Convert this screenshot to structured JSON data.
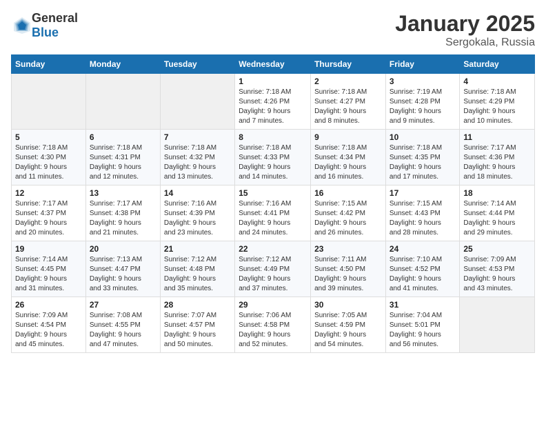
{
  "logo": {
    "general": "General",
    "blue": "Blue"
  },
  "title": "January 2025",
  "location": "Sergokala, Russia",
  "days_of_week": [
    "Sunday",
    "Monday",
    "Tuesday",
    "Wednesday",
    "Thursday",
    "Friday",
    "Saturday"
  ],
  "weeks": [
    [
      {
        "day": "",
        "info": ""
      },
      {
        "day": "",
        "info": ""
      },
      {
        "day": "",
        "info": ""
      },
      {
        "day": "1",
        "info": "Sunrise: 7:18 AM\nSunset: 4:26 PM\nDaylight: 9 hours\nand 7 minutes."
      },
      {
        "day": "2",
        "info": "Sunrise: 7:18 AM\nSunset: 4:27 PM\nDaylight: 9 hours\nand 8 minutes."
      },
      {
        "day": "3",
        "info": "Sunrise: 7:19 AM\nSunset: 4:28 PM\nDaylight: 9 hours\nand 9 minutes."
      },
      {
        "day": "4",
        "info": "Sunrise: 7:18 AM\nSunset: 4:29 PM\nDaylight: 9 hours\nand 10 minutes."
      }
    ],
    [
      {
        "day": "5",
        "info": "Sunrise: 7:18 AM\nSunset: 4:30 PM\nDaylight: 9 hours\nand 11 minutes."
      },
      {
        "day": "6",
        "info": "Sunrise: 7:18 AM\nSunset: 4:31 PM\nDaylight: 9 hours\nand 12 minutes."
      },
      {
        "day": "7",
        "info": "Sunrise: 7:18 AM\nSunset: 4:32 PM\nDaylight: 9 hours\nand 13 minutes."
      },
      {
        "day": "8",
        "info": "Sunrise: 7:18 AM\nSunset: 4:33 PM\nDaylight: 9 hours\nand 14 minutes."
      },
      {
        "day": "9",
        "info": "Sunrise: 7:18 AM\nSunset: 4:34 PM\nDaylight: 9 hours\nand 16 minutes."
      },
      {
        "day": "10",
        "info": "Sunrise: 7:18 AM\nSunset: 4:35 PM\nDaylight: 9 hours\nand 17 minutes."
      },
      {
        "day": "11",
        "info": "Sunrise: 7:17 AM\nSunset: 4:36 PM\nDaylight: 9 hours\nand 18 minutes."
      }
    ],
    [
      {
        "day": "12",
        "info": "Sunrise: 7:17 AM\nSunset: 4:37 PM\nDaylight: 9 hours\nand 20 minutes."
      },
      {
        "day": "13",
        "info": "Sunrise: 7:17 AM\nSunset: 4:38 PM\nDaylight: 9 hours\nand 21 minutes."
      },
      {
        "day": "14",
        "info": "Sunrise: 7:16 AM\nSunset: 4:39 PM\nDaylight: 9 hours\nand 23 minutes."
      },
      {
        "day": "15",
        "info": "Sunrise: 7:16 AM\nSunset: 4:41 PM\nDaylight: 9 hours\nand 24 minutes."
      },
      {
        "day": "16",
        "info": "Sunrise: 7:15 AM\nSunset: 4:42 PM\nDaylight: 9 hours\nand 26 minutes."
      },
      {
        "day": "17",
        "info": "Sunrise: 7:15 AM\nSunset: 4:43 PM\nDaylight: 9 hours\nand 28 minutes."
      },
      {
        "day": "18",
        "info": "Sunrise: 7:14 AM\nSunset: 4:44 PM\nDaylight: 9 hours\nand 29 minutes."
      }
    ],
    [
      {
        "day": "19",
        "info": "Sunrise: 7:14 AM\nSunset: 4:45 PM\nDaylight: 9 hours\nand 31 minutes."
      },
      {
        "day": "20",
        "info": "Sunrise: 7:13 AM\nSunset: 4:47 PM\nDaylight: 9 hours\nand 33 minutes."
      },
      {
        "day": "21",
        "info": "Sunrise: 7:12 AM\nSunset: 4:48 PM\nDaylight: 9 hours\nand 35 minutes."
      },
      {
        "day": "22",
        "info": "Sunrise: 7:12 AM\nSunset: 4:49 PM\nDaylight: 9 hours\nand 37 minutes."
      },
      {
        "day": "23",
        "info": "Sunrise: 7:11 AM\nSunset: 4:50 PM\nDaylight: 9 hours\nand 39 minutes."
      },
      {
        "day": "24",
        "info": "Sunrise: 7:10 AM\nSunset: 4:52 PM\nDaylight: 9 hours\nand 41 minutes."
      },
      {
        "day": "25",
        "info": "Sunrise: 7:09 AM\nSunset: 4:53 PM\nDaylight: 9 hours\nand 43 minutes."
      }
    ],
    [
      {
        "day": "26",
        "info": "Sunrise: 7:09 AM\nSunset: 4:54 PM\nDaylight: 9 hours\nand 45 minutes."
      },
      {
        "day": "27",
        "info": "Sunrise: 7:08 AM\nSunset: 4:55 PM\nDaylight: 9 hours\nand 47 minutes."
      },
      {
        "day": "28",
        "info": "Sunrise: 7:07 AM\nSunset: 4:57 PM\nDaylight: 9 hours\nand 50 minutes."
      },
      {
        "day": "29",
        "info": "Sunrise: 7:06 AM\nSunset: 4:58 PM\nDaylight: 9 hours\nand 52 minutes."
      },
      {
        "day": "30",
        "info": "Sunrise: 7:05 AM\nSunset: 4:59 PM\nDaylight: 9 hours\nand 54 minutes."
      },
      {
        "day": "31",
        "info": "Sunrise: 7:04 AM\nSunset: 5:01 PM\nDaylight: 9 hours\nand 56 minutes."
      },
      {
        "day": "",
        "info": ""
      }
    ]
  ]
}
